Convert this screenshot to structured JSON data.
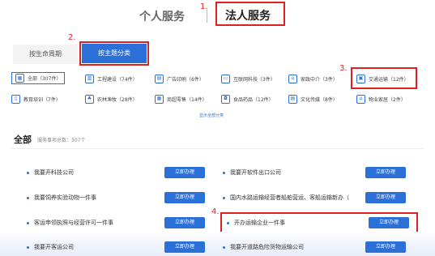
{
  "header": {
    "tab_personal": "个人服务",
    "step1": "1.",
    "tab_legal": "法人服务"
  },
  "subtabs": {
    "step2": "2.",
    "by_life": "按生命周期",
    "by_theme": "按主题分类"
  },
  "categories": {
    "step3": "3.",
    "items": [
      {
        "label": "全部（307件）",
        "icon": "grid-icon"
      },
      {
        "label": "工程建设（74件）",
        "icon": "building-icon"
      },
      {
        "label": "广告印刷（6件）",
        "icon": "print-icon"
      },
      {
        "label": "互联网科技（3件）",
        "icon": "monitor-icon"
      },
      {
        "label": "家政中介（3件）",
        "icon": "home-icon"
      },
      {
        "label": "交通运输（12件）",
        "icon": "bus-icon"
      },
      {
        "label": "教育培训（7件）",
        "icon": "book-icon"
      },
      {
        "label": "农林渔牧（28件）",
        "icon": "leaf-icon"
      },
      {
        "label": "商超零售（14件）",
        "icon": "cart-icon"
      },
      {
        "label": "食品药品（12件）",
        "icon": "pill-icon"
      },
      {
        "label": "文化传媒（8件）",
        "icon": "media-icon"
      },
      {
        "label": "物业家居（2件）",
        "icon": "house-icon"
      }
    ],
    "show_all": "显示全部分类"
  },
  "section": {
    "title": "全部",
    "subtitle": "服务事项总数：307个"
  },
  "list": {
    "step4": "4.",
    "button_label": "立即办理",
    "left": [
      "我要开科技公司",
      "我要饲养实验动物一件事",
      "客运申领执照与经营许可一件事",
      "我要开客运公司"
    ],
    "right": [
      "我要开软件出口公司",
      "国内水路运输经营者船舶营运、客船运输新办（",
      "开办运输企业一件事",
      "我要开道路危险货物运输公司"
    ]
  },
  "colors": {
    "accent": "#2b6fd8",
    "annotation": "#e02020"
  }
}
